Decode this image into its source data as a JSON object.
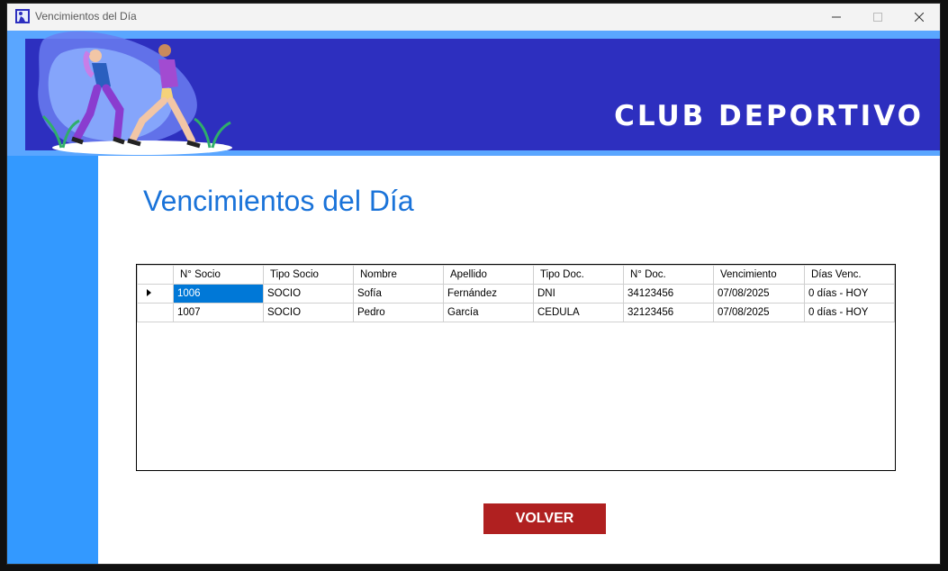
{
  "window": {
    "title": "Vencimientos del Día",
    "controls": [
      "minimize",
      "maximize",
      "close"
    ]
  },
  "banner": {
    "title": "CLUB DEPORTIVO",
    "image": "runners-illustration"
  },
  "page": {
    "heading": "Vencimientos del Día"
  },
  "table": {
    "columns": [
      "N° Socio",
      "Tipo Socio",
      "Nombre",
      "Apellido",
      "Tipo Doc.",
      "N° Doc.",
      "Vencimiento",
      "Días Venc."
    ],
    "rows": [
      [
        "1006",
        "SOCIO",
        "Sofía",
        "Fernández",
        "DNI",
        "34123456",
        "07/08/2025",
        "0 días - HOY"
      ],
      [
        "1007",
        "SOCIO",
        "Pedro",
        "García",
        "CEDULA",
        "32123456",
        "07/08/2025",
        "0 días - HOY"
      ]
    ],
    "current_row": 0
  },
  "buttons": {
    "volver": "VOLVER"
  },
  "colors": {
    "banner": "#2d2fbf",
    "sidebar": "#3399ff",
    "heading": "#1a73d9",
    "button": "#b02020",
    "selection": "#0078d7"
  }
}
